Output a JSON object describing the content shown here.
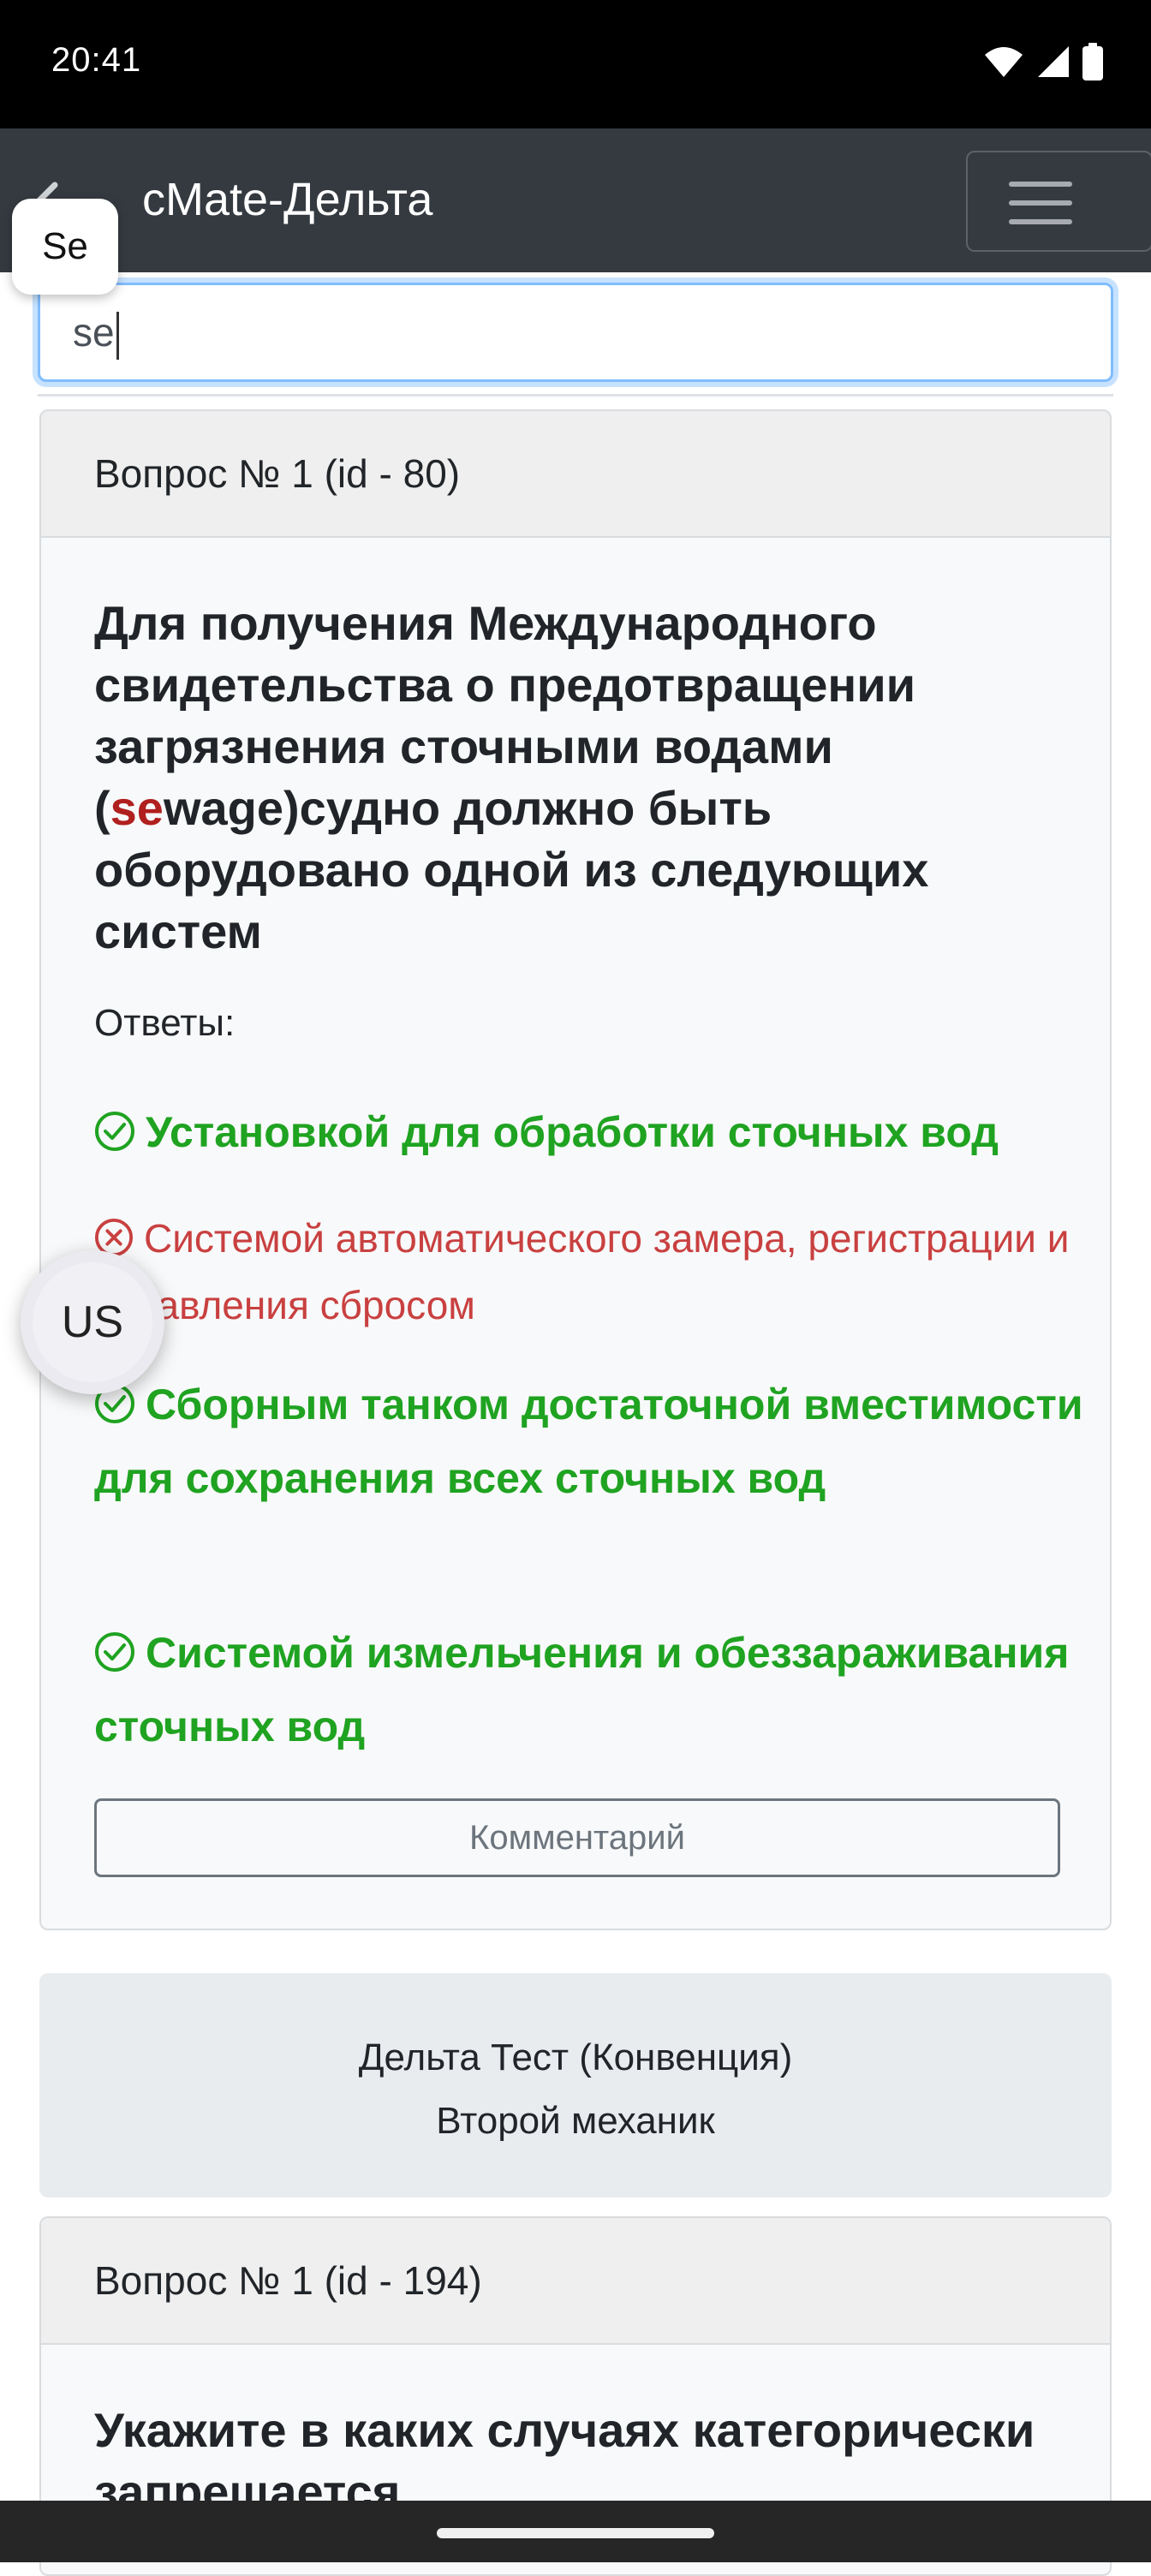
{
  "status_bar": {
    "time": "20:41",
    "icons": [
      "wifi-icon",
      "signal-icon",
      "battery-icon"
    ]
  },
  "navbar": {
    "title": "cMate-Дельта",
    "back_icon": "back-arrow-icon",
    "menu_icon": "hamburger-menu-icon"
  },
  "keyboard_suggestion": "Se",
  "search": {
    "value": "se"
  },
  "question1": {
    "header": "Вопрос № 1 (id - 80)",
    "title_before": "Для получения Международного свидетельства о предотвращении загрязнения сточными водами (",
    "title_highlight": "se",
    "title_after": "wage)судно должно быть оборудовано одной из следующих систем",
    "answers_label": "Ответы:",
    "answers": [
      {
        "text": "Установкой для обработки сточных вод",
        "status": "correct"
      },
      {
        "text": "Системой автоматического замера, регистрации и управления сбросом",
        "status": "incorrect"
      },
      {
        "text": "Сборным танком достаточной вместимости для сохранения всех сточных вод",
        "status": "correct"
      },
      {
        "text": "Системой измельчения и обеззараживания сточных вод",
        "status": "correct"
      }
    ],
    "comment_button": "Комментарий"
  },
  "test_info": {
    "line1": "Дельта Тест (Конвенция)",
    "line2": "Второй механик"
  },
  "question2": {
    "header": "Вопрос № 1 (id - 194)",
    "title": "Укажите в каких случаях категорически запрещается"
  },
  "floating_bubble": "US",
  "colors": {
    "correct": "#1fa321",
    "incorrect": "#c94040",
    "highlight": "#b0201e",
    "navbar": "#343a40"
  }
}
